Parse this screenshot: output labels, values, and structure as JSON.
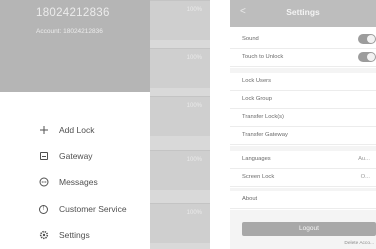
{
  "drawer": {
    "phone_number": "18024212836",
    "account": "Account: 18024212836",
    "menu": [
      {
        "label": "Add Lock",
        "icon": "plus-icon"
      },
      {
        "label": "Gateway",
        "icon": "gateway-icon"
      },
      {
        "label": "Messages",
        "icon": "message-icon"
      },
      {
        "label": "Customer Service",
        "icon": "customer-service-icon"
      },
      {
        "label": "Settings",
        "icon": "gear-icon"
      }
    ]
  },
  "lock_list": {
    "batteries": [
      "100%",
      "100%",
      "100%",
      "100%",
      "100%"
    ]
  },
  "settings": {
    "title": "Settings",
    "rows": [
      {
        "label": "Sound",
        "control": "toggle"
      },
      {
        "label": "Touch to Unlock",
        "control": "toggle"
      },
      {
        "label": "Lock Users"
      },
      {
        "label": "Lock Group"
      },
      {
        "label": "Transfer Lock(s)"
      },
      {
        "label": "Transfer Gateway"
      },
      {
        "label": "Languages",
        "value": "Au..."
      },
      {
        "label": "Screen Lock",
        "value": "O..."
      },
      {
        "label": "About"
      }
    ],
    "logout_label": "Logout",
    "delete_account_label": "Delete Acco..."
  }
}
